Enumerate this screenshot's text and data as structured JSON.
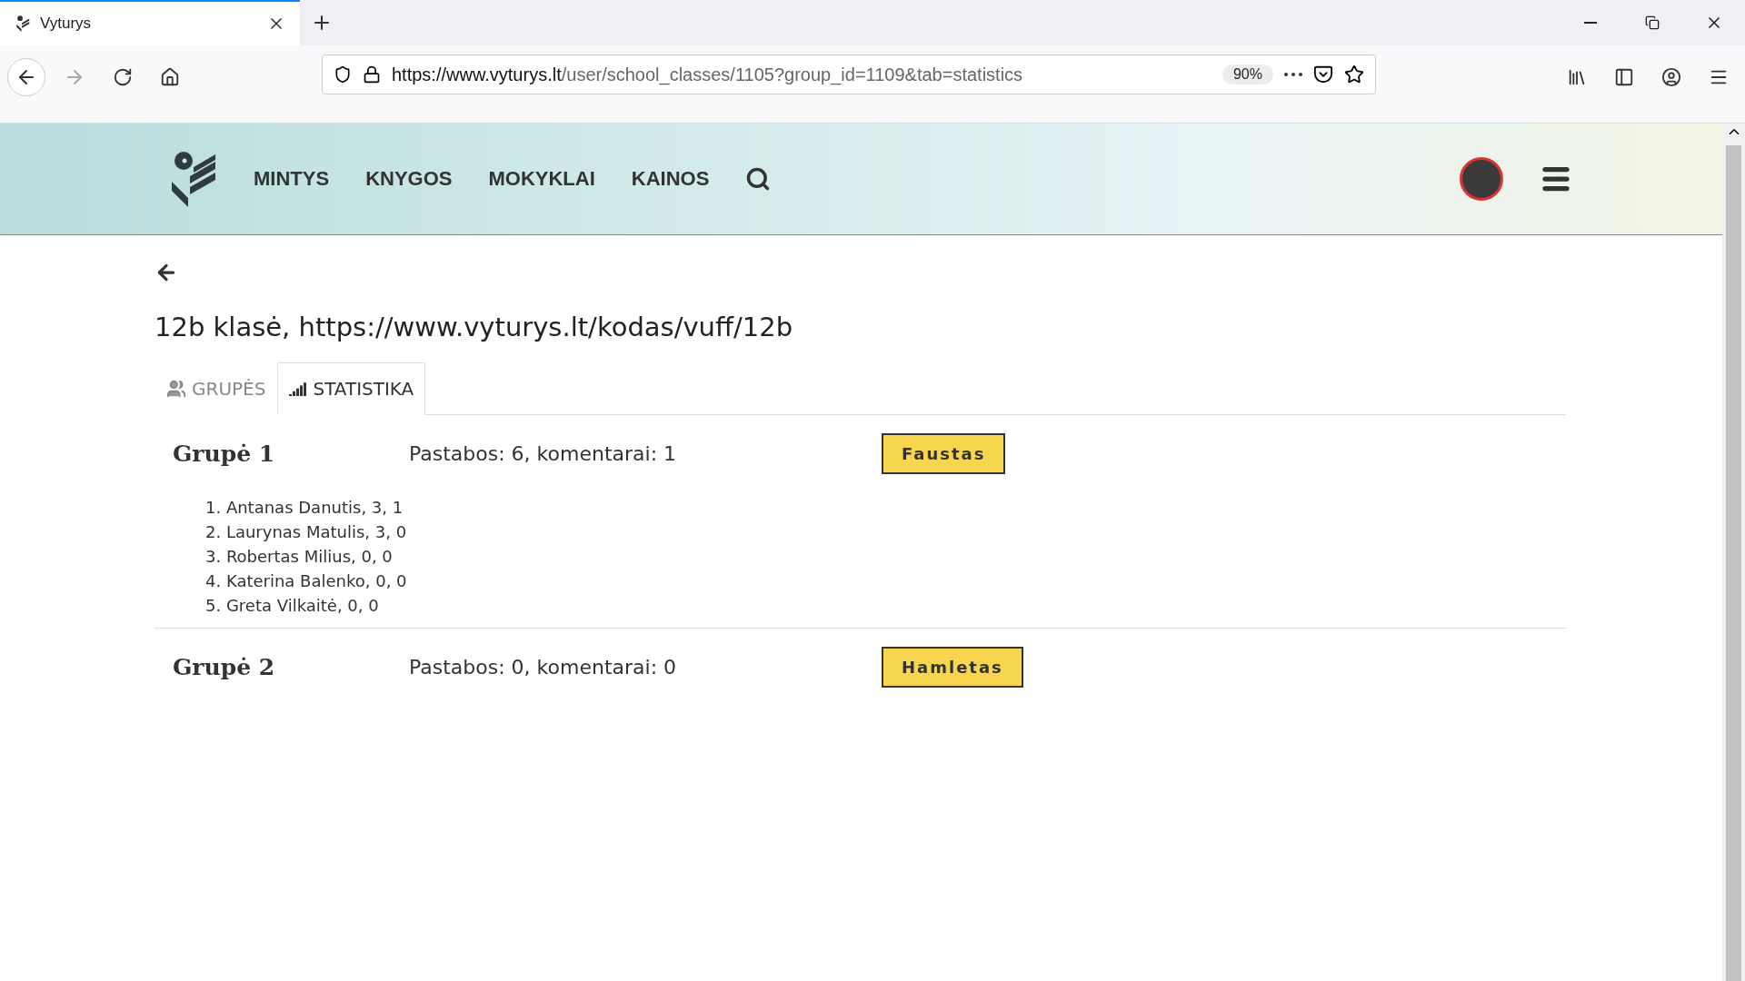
{
  "browser": {
    "tab_title": "Vyturys",
    "url_domain": "https://www.vyturys.lt",
    "url_path": "/user/school_classes/1105?group_id=1109&tab=statistics",
    "zoom": "90%"
  },
  "site_nav": [
    "MINTYS",
    "KNYGOS",
    "MOKYKLAI",
    "KAINOS"
  ],
  "page_title": "12b klasė, https://www.vyturys.lt/kodas/vuff/12b",
  "tabs": [
    {
      "label": "GRUPĖS",
      "selected": false
    },
    {
      "label": "STATISTIKA",
      "selected": true
    }
  ],
  "groups": [
    {
      "name": "Grupė 1",
      "summary": "Pastabos: 6, komentarai: 1",
      "book": "Faustas",
      "members": [
        "1. Antanas Danutis, 3, 1",
        "2. Laurynas Matulis, 3, 0",
        "3. Robertas Milius, 0, 0",
        "4. Katerina Balenko, 0, 0",
        "5. Greta Vilkaitė, 0, 0"
      ]
    },
    {
      "name": "Grupė 2",
      "summary": "Pastabos: 0, komentarai: 0",
      "book": "Hamletas"
    }
  ]
}
